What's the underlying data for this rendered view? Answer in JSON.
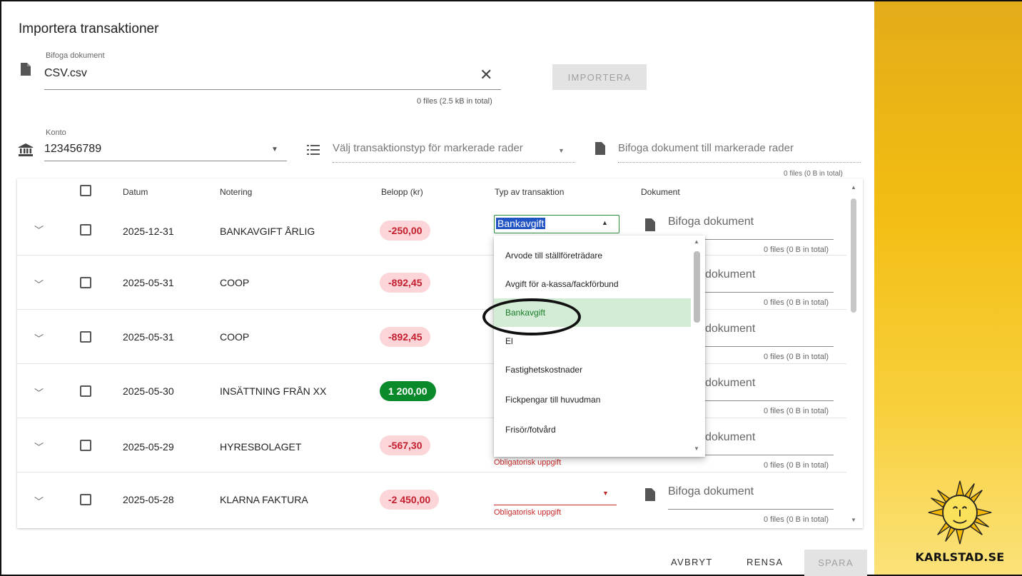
{
  "title": "Importera transaktioner",
  "attach": {
    "label": "Bifoga dokument",
    "value": "CSV.csv",
    "files_info": "0 files (2.5 kB in total)",
    "import_button": "IMPORTERA"
  },
  "account": {
    "label": "Konto",
    "value": "123456789"
  },
  "bulk": {
    "type_placeholder": "Välj transaktionstyp för markerade rader",
    "doc_placeholder": "Bifoga dokument till markerade rader",
    "files_info": "0 files (0 B in total)"
  },
  "table": {
    "headers": {
      "date": "Datum",
      "note": "Notering",
      "amount": "Belopp (kr)",
      "type": "Typ av transaktion",
      "document": "Dokument"
    },
    "rows": [
      {
        "date": "2025-12-31",
        "note": "BANKAVGIFT ÅRLIG",
        "amount": "-250,00",
        "kind": "neg",
        "type": "Bankavgift",
        "doc": "Bifoga dokument",
        "files": "0 files (0 B in total)",
        "error": ""
      },
      {
        "date": "2025-05-31",
        "note": "COOP",
        "amount": "-892,45",
        "kind": "neg",
        "type": "",
        "doc": "dokument",
        "files": "0 files (0 B in total)",
        "error": ""
      },
      {
        "date": "2025-05-31",
        "note": "COOP",
        "amount": "-892,45",
        "kind": "neg",
        "type": "",
        "doc": "dokument",
        "files": "0 files (0 B in total)",
        "error": ""
      },
      {
        "date": "2025-05-30",
        "note": "INSÄTTNING FRÅN XX",
        "amount": "1 200,00",
        "kind": "pos",
        "type": "",
        "doc": "dokument",
        "files": "0 files (0 B in total)",
        "error": ""
      },
      {
        "date": "2025-05-29",
        "note": "HYRESBOLAGET",
        "amount": "-567,30",
        "kind": "neg",
        "type": "",
        "doc": "dokument",
        "files": "0 files (0 B in total)",
        "error": "Obligatorisk uppgift"
      },
      {
        "date": "2025-05-28",
        "note": "KLARNA FAKTURA",
        "amount": "-2 450,00",
        "kind": "neg",
        "type": "",
        "doc": "Bifoga dokument",
        "files": "0 files (0 B in total)",
        "error": "Obligatorisk uppgift"
      }
    ]
  },
  "dropdown_options": [
    "Arvode till ställföreträdare",
    "Avgift för a-kassa/fackförbund",
    "Bankavgift",
    "El",
    "Fastighetskostnader",
    "Fickpengar till huvudman",
    "Frisör/fotvård"
  ],
  "selected_option": "Bankavgift",
  "footer": {
    "cancel": "AVBRYT",
    "clear": "RENSA",
    "save": "SPARA"
  },
  "brand": {
    "text": "KARLSTAD.SE"
  },
  "colors": {
    "negative_bg": "#fbd5d8",
    "negative_text": "#c41e2e",
    "positive_bg": "#0b8a2b",
    "selected_bg": "#d3ecd5",
    "accent_green": "#1a7d2a",
    "brand_yellow": "#f2bd12"
  }
}
